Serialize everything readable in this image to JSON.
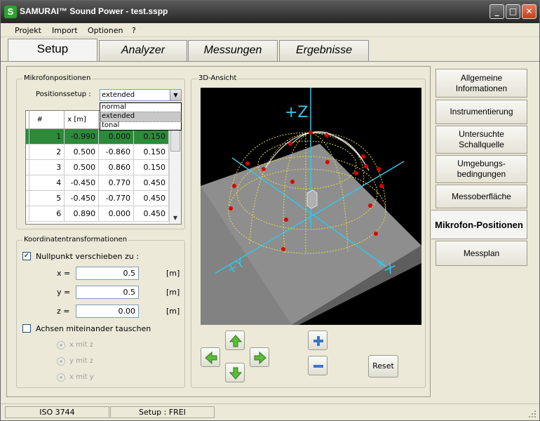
{
  "window": {
    "app_logo": "S",
    "title": "SAMURAI™ Sound Power - test.sspp",
    "minimize": "_",
    "maximize": "□",
    "close": "✕"
  },
  "menu": [
    "Projekt",
    "Import",
    "Optionen",
    "?"
  ],
  "main_tabs": [
    "Setup",
    "Analyzer",
    "Messungen",
    "Ergebnisse"
  ],
  "active_main_tab": "Setup",
  "mikrofon": {
    "group_title": "Mikrofonpositionen",
    "setup_label": "Positionssetup :",
    "setup_value": "extended",
    "options": [
      "normal",
      "extended",
      "tonal"
    ],
    "selected_option": "extended",
    "columns": [
      "#",
      "x [m]"
    ],
    "rows": [
      {
        "n": "1",
        "x": "-0.990",
        "y": "0.000",
        "z": "0.150"
      },
      {
        "n": "2",
        "x": "0.500",
        "y": "-0.860",
        "z": "0.150"
      },
      {
        "n": "3",
        "x": "0.500",
        "y": "0.860",
        "z": "0.150"
      },
      {
        "n": "4",
        "x": "-0.450",
        "y": "0.770",
        "z": "0.450"
      },
      {
        "n": "5",
        "x": "-0.450",
        "y": "-0.770",
        "z": "0.450"
      },
      {
        "n": "6",
        "x": "0.890",
        "y": "0.000",
        "z": "0.450"
      }
    ],
    "selected_row": 0
  },
  "koordinaten": {
    "group_title": "Koordinatentransformationen",
    "shift_label": "Nullpunkt verschieben zu :",
    "shift_checked": true,
    "fields": [
      {
        "label": "x =",
        "value": "0.5",
        "unit": "[m]"
      },
      {
        "label": "y =",
        "value": "0.5",
        "unit": "[m]"
      },
      {
        "label": "z =",
        "value": "0.00",
        "unit": "[m]"
      }
    ],
    "swap_label": "Achsen miteinander tauschen",
    "swap_checked": false,
    "radios": [
      "x mit z",
      "y mit z",
      "x mit y"
    ]
  },
  "view3d": {
    "group_title": "3D-Ansicht",
    "axis_labels": [
      "+Z",
      "+Y",
      "+X"
    ],
    "reset_label": "Reset"
  },
  "side_tabs": [
    "Allgemeine Informationen",
    "Instrumentierung",
    "Untersuchte Schallquelle",
    "Umgebungs-bedingungen",
    "Messoberfläche",
    "Mikrofon-Positionen",
    "Messplan"
  ],
  "active_side_tab": "Mikrofon-Positionen",
  "status": [
    "ISO 3744",
    "Setup : FREI"
  ],
  "colors": {
    "selection_green": "#2c8a3a",
    "mic_point_red": "#e00000",
    "axis_cyan": "#33c6e8",
    "hemisphere_yellow": "#e8dc40"
  }
}
